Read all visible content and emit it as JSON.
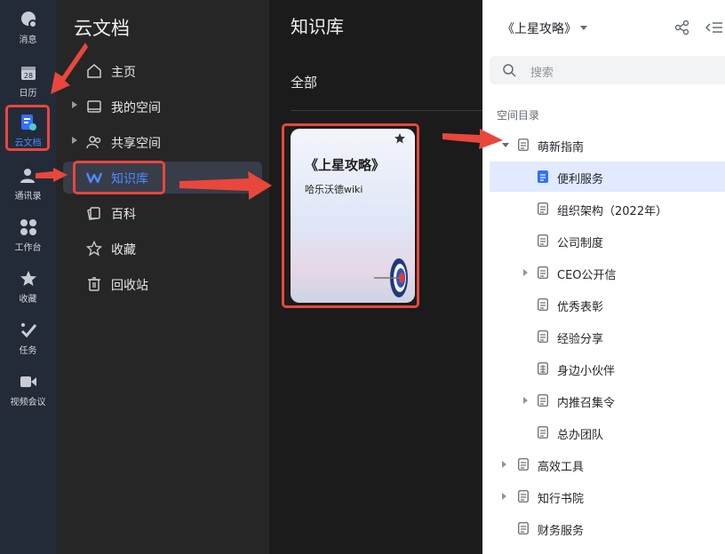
{
  "rail": {
    "items": [
      {
        "label": "消息",
        "icon": "message-icon"
      },
      {
        "label": "日历",
        "icon": "calendar-icon",
        "day": "28"
      },
      {
        "label": "云文档",
        "icon": "cloud-docs-icon"
      },
      {
        "label": "通讯录",
        "icon": "contacts-icon"
      },
      {
        "label": "工作台",
        "icon": "workbench-icon"
      },
      {
        "label": "收藏",
        "icon": "star-icon"
      },
      {
        "label": "任务",
        "icon": "task-icon"
      },
      {
        "label": "视频会议",
        "icon": "video-icon"
      }
    ]
  },
  "sidebar": {
    "title": "云文档",
    "items": [
      {
        "label": "主页",
        "icon": "home-icon"
      },
      {
        "label": "我的空间",
        "icon": "folder-icon"
      },
      {
        "label": "共享空间",
        "icon": "shared-icon"
      },
      {
        "label": "知识库",
        "icon": "wiki-icon"
      },
      {
        "label": "百科",
        "icon": "encyclopedia-icon"
      },
      {
        "label": "收藏",
        "icon": "star-icon"
      },
      {
        "label": "回收站",
        "icon": "trash-icon"
      }
    ]
  },
  "center": {
    "title": "知识库",
    "tab": "全部",
    "card": {
      "title": "《上星攻略》",
      "subtitle": "哈乐沃德wiki"
    }
  },
  "right": {
    "space_name": "《上星攻略》",
    "search_placeholder": "搜索",
    "section_label": "空间目录",
    "tree": [
      {
        "label": "萌新指南"
      },
      {
        "label": "便利服务"
      },
      {
        "label": "组织架构（2022年）"
      },
      {
        "label": "公司制度"
      },
      {
        "label": "CEO公开信"
      },
      {
        "label": "优秀表彰"
      },
      {
        "label": "经验分享"
      },
      {
        "label": "身边小伙伴"
      },
      {
        "label": "内推召集令"
      },
      {
        "label": "总办团队"
      },
      {
        "label": "高效工具"
      },
      {
        "label": "知行书院"
      },
      {
        "label": "财务服务"
      }
    ]
  },
  "colors": {
    "accent": "#4d8bff",
    "highlight": "#e9473c",
    "selected_row": "#e1eaff"
  }
}
